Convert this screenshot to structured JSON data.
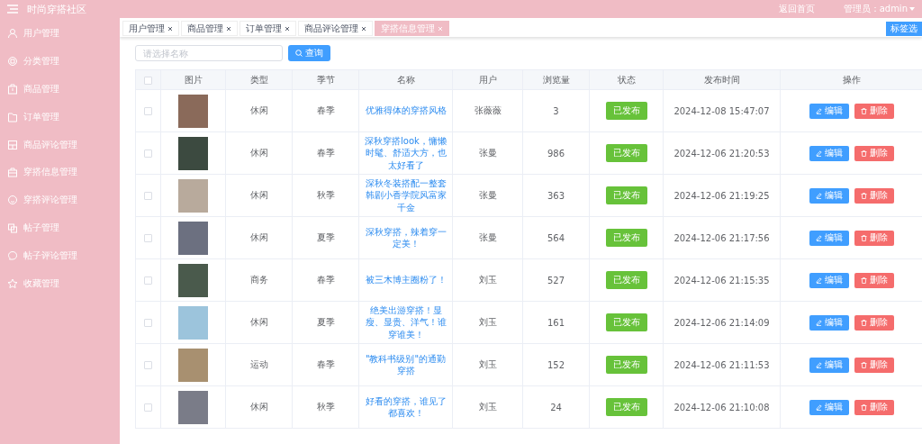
{
  "header": {
    "title": "时尚穿搭社区",
    "home_link": "返回首页",
    "user_menu": "管理员：admin"
  },
  "sidebar": {
    "items": [
      {
        "label": "用户管理",
        "selected": false
      },
      {
        "label": "分类管理",
        "selected": false
      },
      {
        "label": "商品管理",
        "selected": false
      },
      {
        "label": "订单管理",
        "selected": false
      },
      {
        "label": "商品评论管理",
        "selected": false
      },
      {
        "label": "穿搭信息管理",
        "selected": false
      },
      {
        "label": "穿搭评论管理",
        "selected": false
      },
      {
        "label": "帖子管理",
        "selected": false
      },
      {
        "label": "帖子评论管理",
        "selected": false
      },
      {
        "label": "收藏管理",
        "selected": false
      }
    ]
  },
  "tabs": [
    {
      "label": "用户管理",
      "selected": false
    },
    {
      "label": "商品管理",
      "selected": false
    },
    {
      "label": "订单管理",
      "selected": false
    },
    {
      "label": "商品评论管理",
      "selected": false
    },
    {
      "label": "穿搭信息管理",
      "selected": true
    }
  ],
  "tab_options_button": "标签选",
  "search": {
    "placeholder": "请选择名称",
    "button": "查询"
  },
  "table": {
    "header_checked": false,
    "columns": [
      "图片",
      "类型",
      "季节",
      "名称",
      "用户",
      "浏览量",
      "状态",
      "发布时间",
      "操作"
    ],
    "rows": [
      {
        "checked": false,
        "type": "休闲",
        "season": "春季",
        "name": "优雅得体的穿搭风格",
        "user": "张薇薇",
        "views": "3",
        "status": "已发布",
        "time": "2024-12-08 15:47:07",
        "edit": "编辑",
        "delete": "删除"
      },
      {
        "checked": false,
        "type": "休闲",
        "season": "春季",
        "name": "深秋穿搭look，慵懒时髦、舒适大方，也太好看了",
        "user": "张曼",
        "views": "986",
        "status": "已发布",
        "time": "2024-12-06 21:20:53",
        "edit": "编辑",
        "delete": "删除"
      },
      {
        "checked": false,
        "type": "休闲",
        "season": "秋季",
        "name": "深秋冬装搭配一整套韩剧小香学院风富家千金",
        "user": "张曼",
        "views": "363",
        "status": "已发布",
        "time": "2024-12-06 21:19:25",
        "edit": "编辑",
        "delete": "删除"
      },
      {
        "checked": false,
        "type": "休闲",
        "season": "夏季",
        "name": "深秋穿搭，辣着穿一定美！",
        "user": "张曼",
        "views": "564",
        "status": "已发布",
        "time": "2024-12-06 21:17:56",
        "edit": "编辑",
        "delete": "删除"
      },
      {
        "checked": false,
        "type": "商务",
        "season": "春季",
        "name": "被三木博主圈粉了！",
        "user": "刘玉",
        "views": "527",
        "status": "已发布",
        "time": "2024-12-06 21:15:35",
        "edit": "编辑",
        "delete": "删除"
      },
      {
        "checked": false,
        "type": "休闲",
        "season": "夏季",
        "name": "绝美出游穿搭！显瘦、显贵、洋气！谁穿谁美！",
        "user": "刘玉",
        "views": "161",
        "status": "已发布",
        "time": "2024-12-06 21:14:09",
        "edit": "编辑",
        "delete": "删除"
      },
      {
        "checked": false,
        "type": "运动",
        "season": "春季",
        "name": "\"教科书级别\"的通勤穿搭",
        "user": "刘玉",
        "views": "152",
        "status": "已发布",
        "time": "2024-12-06 21:11:53",
        "edit": "编辑",
        "delete": "删除"
      },
      {
        "checked": false,
        "type": "休闲",
        "season": "秋季",
        "name": "好看的穿搭，谁见了都喜欢！",
        "user": "刘玉",
        "views": "24",
        "status": "已发布",
        "time": "2024-12-06 21:10:08",
        "edit": "编辑",
        "delete": "删除"
      }
    ]
  }
}
